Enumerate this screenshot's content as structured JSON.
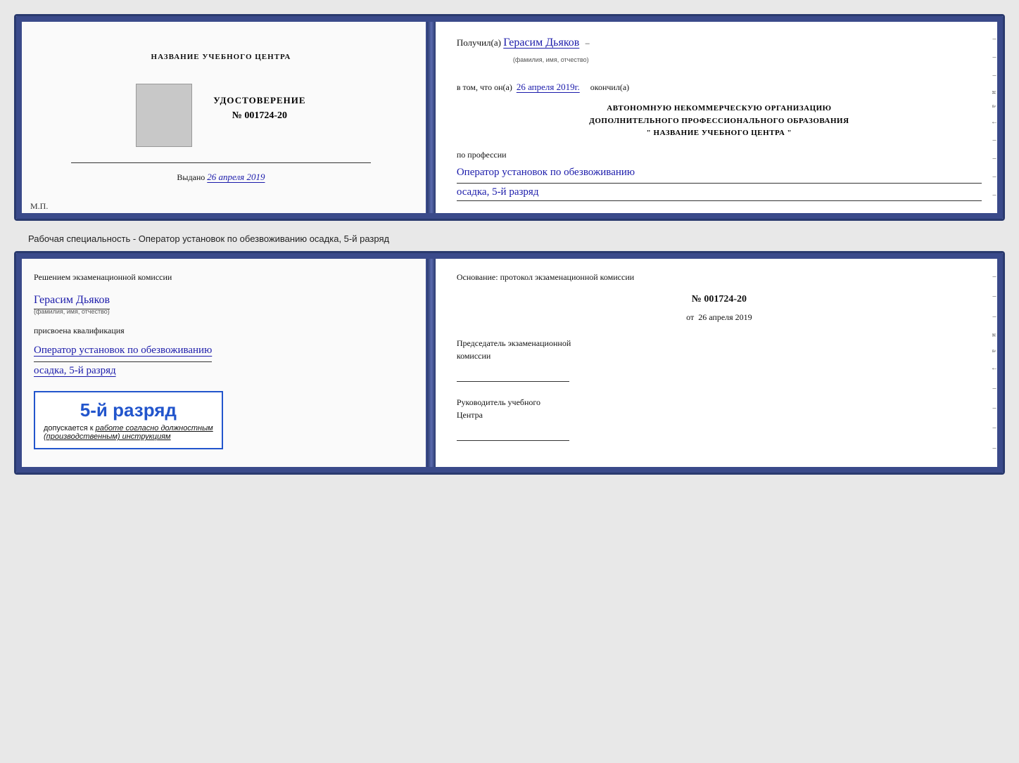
{
  "top_doc": {
    "left": {
      "center_title": "НАЗВАНИЕ УЧЕБНОГО ЦЕНТРА",
      "cert_label": "УДОСТОВЕРЕНИЕ",
      "cert_number": "№ 001724-20",
      "issued_label": "Выдано",
      "issued_date": "26 апреля 2019",
      "mp_label": "М.П."
    },
    "right": {
      "received_label": "Получил(а)",
      "recipient_name": "Герасим Дьяков",
      "name_hint": "(фамилия, имя, отчество)",
      "in_that_label": "в том, что он(а)",
      "completion_date": "26 апреля 2019г.",
      "completed_label": "окончил(а)",
      "org_line1": "АВТОНОМНУЮ НЕКОММЕРЧЕСКУЮ ОРГАНИЗАЦИЮ",
      "org_line2": "ДОПОЛНИТЕЛЬНОГО ПРОФЕССИОНАЛЬНОГО ОБРАЗОВАНИЯ",
      "org_line3": "\" НАЗВАНИЕ УЧЕБНОГО ЦЕНТРА \"",
      "profession_label": "по профессии",
      "profession_line1": "Оператор установок по обезвоживанию",
      "profession_line2": "осадка, 5-й разряд"
    }
  },
  "separator": {
    "text": "Рабочая специальность - Оператор установок по обезвоживанию осадка, 5-й разряд"
  },
  "bottom_doc": {
    "left": {
      "decision_text": "Решением экзаменационной комиссии",
      "name": "Герасим Дьяков",
      "name_hint": "(фамилия, имя, отчество)",
      "assigned_label": "присвоена квалификация",
      "qualification_line1": "Оператор установок по обезвоживанию",
      "qualification_line2": "осадка, 5-й разряд",
      "stamp_rank": "5-й разряд",
      "stamp_admission": "допускается к",
      "stamp_work": "работе согласно должностным",
      "stamp_instructions": "(производственным) инструкциям"
    },
    "right": {
      "basis_label": "Основание: протокол экзаменационной комиссии",
      "protocol_number": "№ 001724-20",
      "from_label": "от",
      "from_date": "26 апреля 2019",
      "chairman_label": "Председатель экзаменационной",
      "chairman_label2": "комиссии",
      "director_label": "Руководитель учебного",
      "director_label2": "Центра"
    }
  },
  "side_marks": {
    "marks": [
      "–",
      "–",
      "–",
      "и",
      "а",
      "←",
      "–",
      "–",
      "–",
      "–"
    ]
  }
}
